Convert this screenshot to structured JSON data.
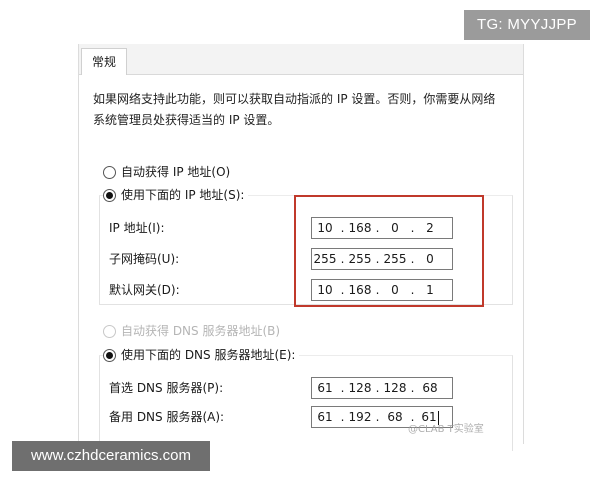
{
  "watermark": {
    "top_right": "TG: MYYJJPP",
    "corner_mark": "@CLAB T实验室"
  },
  "banner": {
    "url": "www.czhdceramics.com"
  },
  "dialog": {
    "tab_label": "常规",
    "description_line1": "如果网络支持此功能，则可以获取自动指派的 IP 设置。否则，你需要从网络",
    "description_line2": "系统管理员处获得适当的 IP 设置。",
    "ip_section": {
      "auto_option": "自动获得 IP 地址(O)",
      "manual_option": "使用下面的 IP 地址(S):",
      "auto_checked": false,
      "manual_checked": true,
      "fields": [
        {
          "label": "IP 地址(I):",
          "octets": [
            "10",
            "168",
            "0",
            "2"
          ]
        },
        {
          "label": "子网掩码(U):",
          "octets": [
            "255",
            "255",
            "255",
            "0"
          ]
        },
        {
          "label": "默认网关(D):",
          "octets": [
            "10",
            "168",
            "0",
            "1"
          ]
        }
      ]
    },
    "dns_section": {
      "auto_option": "自动获得 DNS 服务器地址(B)",
      "manual_option": "使用下面的 DNS 服务器地址(E):",
      "auto_disabled": true,
      "manual_checked": true,
      "fields": [
        {
          "label": "首选 DNS 服务器(P):",
          "octets": [
            "61",
            "128",
            "128",
            "68"
          ]
        },
        {
          "label": "备用 DNS 服务器(A):",
          "octets": [
            "61",
            "192",
            "68",
            "61"
          ]
        }
      ]
    }
  },
  "colors": {
    "highlight_border": "#c0392b",
    "badge_bg": "#9b9b9b",
    "banner_bg": "#6f6f6f"
  }
}
